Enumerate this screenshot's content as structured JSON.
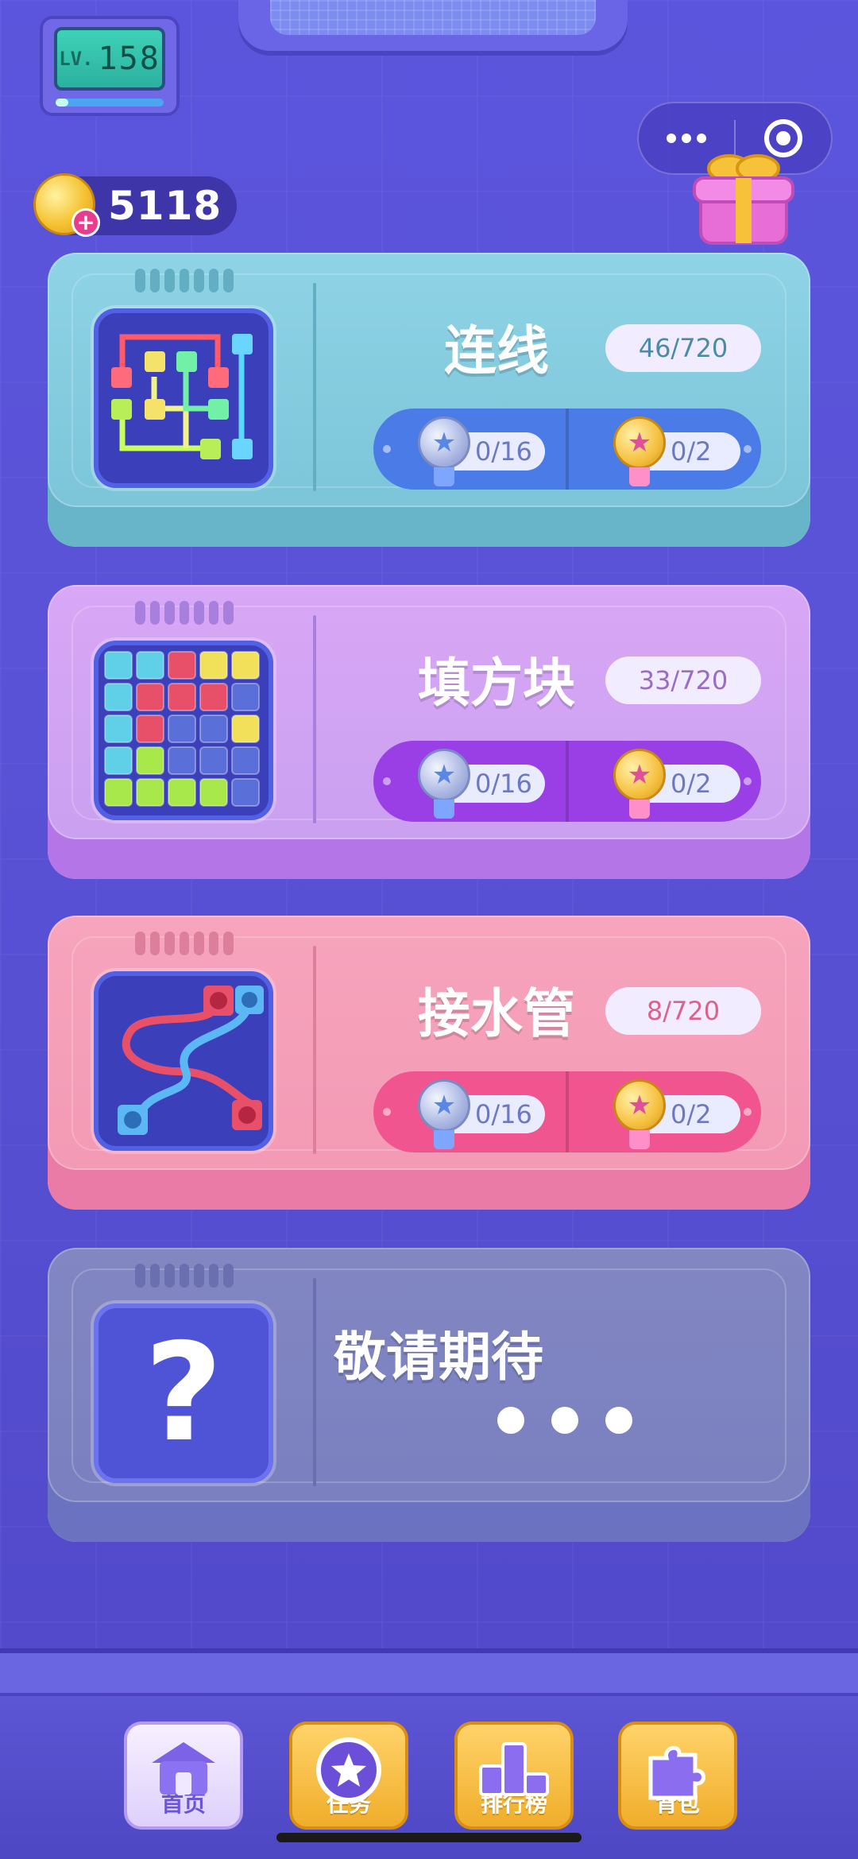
{
  "level": {
    "prefix": "LV.",
    "value": "158",
    "progress": 0.12
  },
  "coins": {
    "value": "5118"
  },
  "capsule": {
    "more_icon": "more-dots-icon",
    "close_icon": "target-icon"
  },
  "cards": [
    {
      "title": "连线",
      "progress": "46/720",
      "silver": "0/16",
      "gold": "0/2",
      "thumb_icon": "line-puzzle-icon"
    },
    {
      "title": "填方块",
      "progress": "33/720",
      "silver": "0/16",
      "gold": "0/2",
      "thumb_icon": "block-grid-icon"
    },
    {
      "title": "接水管",
      "progress": "8/720",
      "silver": "0/16",
      "gold": "0/2",
      "thumb_icon": "pipes-icon"
    },
    {
      "title": "敬请期待",
      "thumb_icon": "question-icon",
      "thumb_glyph": "?"
    }
  ],
  "nav": [
    {
      "label": "首页",
      "icon": "home-icon"
    },
    {
      "label": "任务",
      "icon": "star-badge-icon"
    },
    {
      "label": "排行榜",
      "icon": "podium-icon"
    },
    {
      "label": "背包",
      "icon": "puzzle-piece-icon"
    }
  ],
  "colors": {
    "background": "#5a52d6",
    "card1": "#8fd3e6",
    "card2": "#d9a7f6",
    "card3": "#f7a4bd",
    "card4": "#8287c2"
  }
}
